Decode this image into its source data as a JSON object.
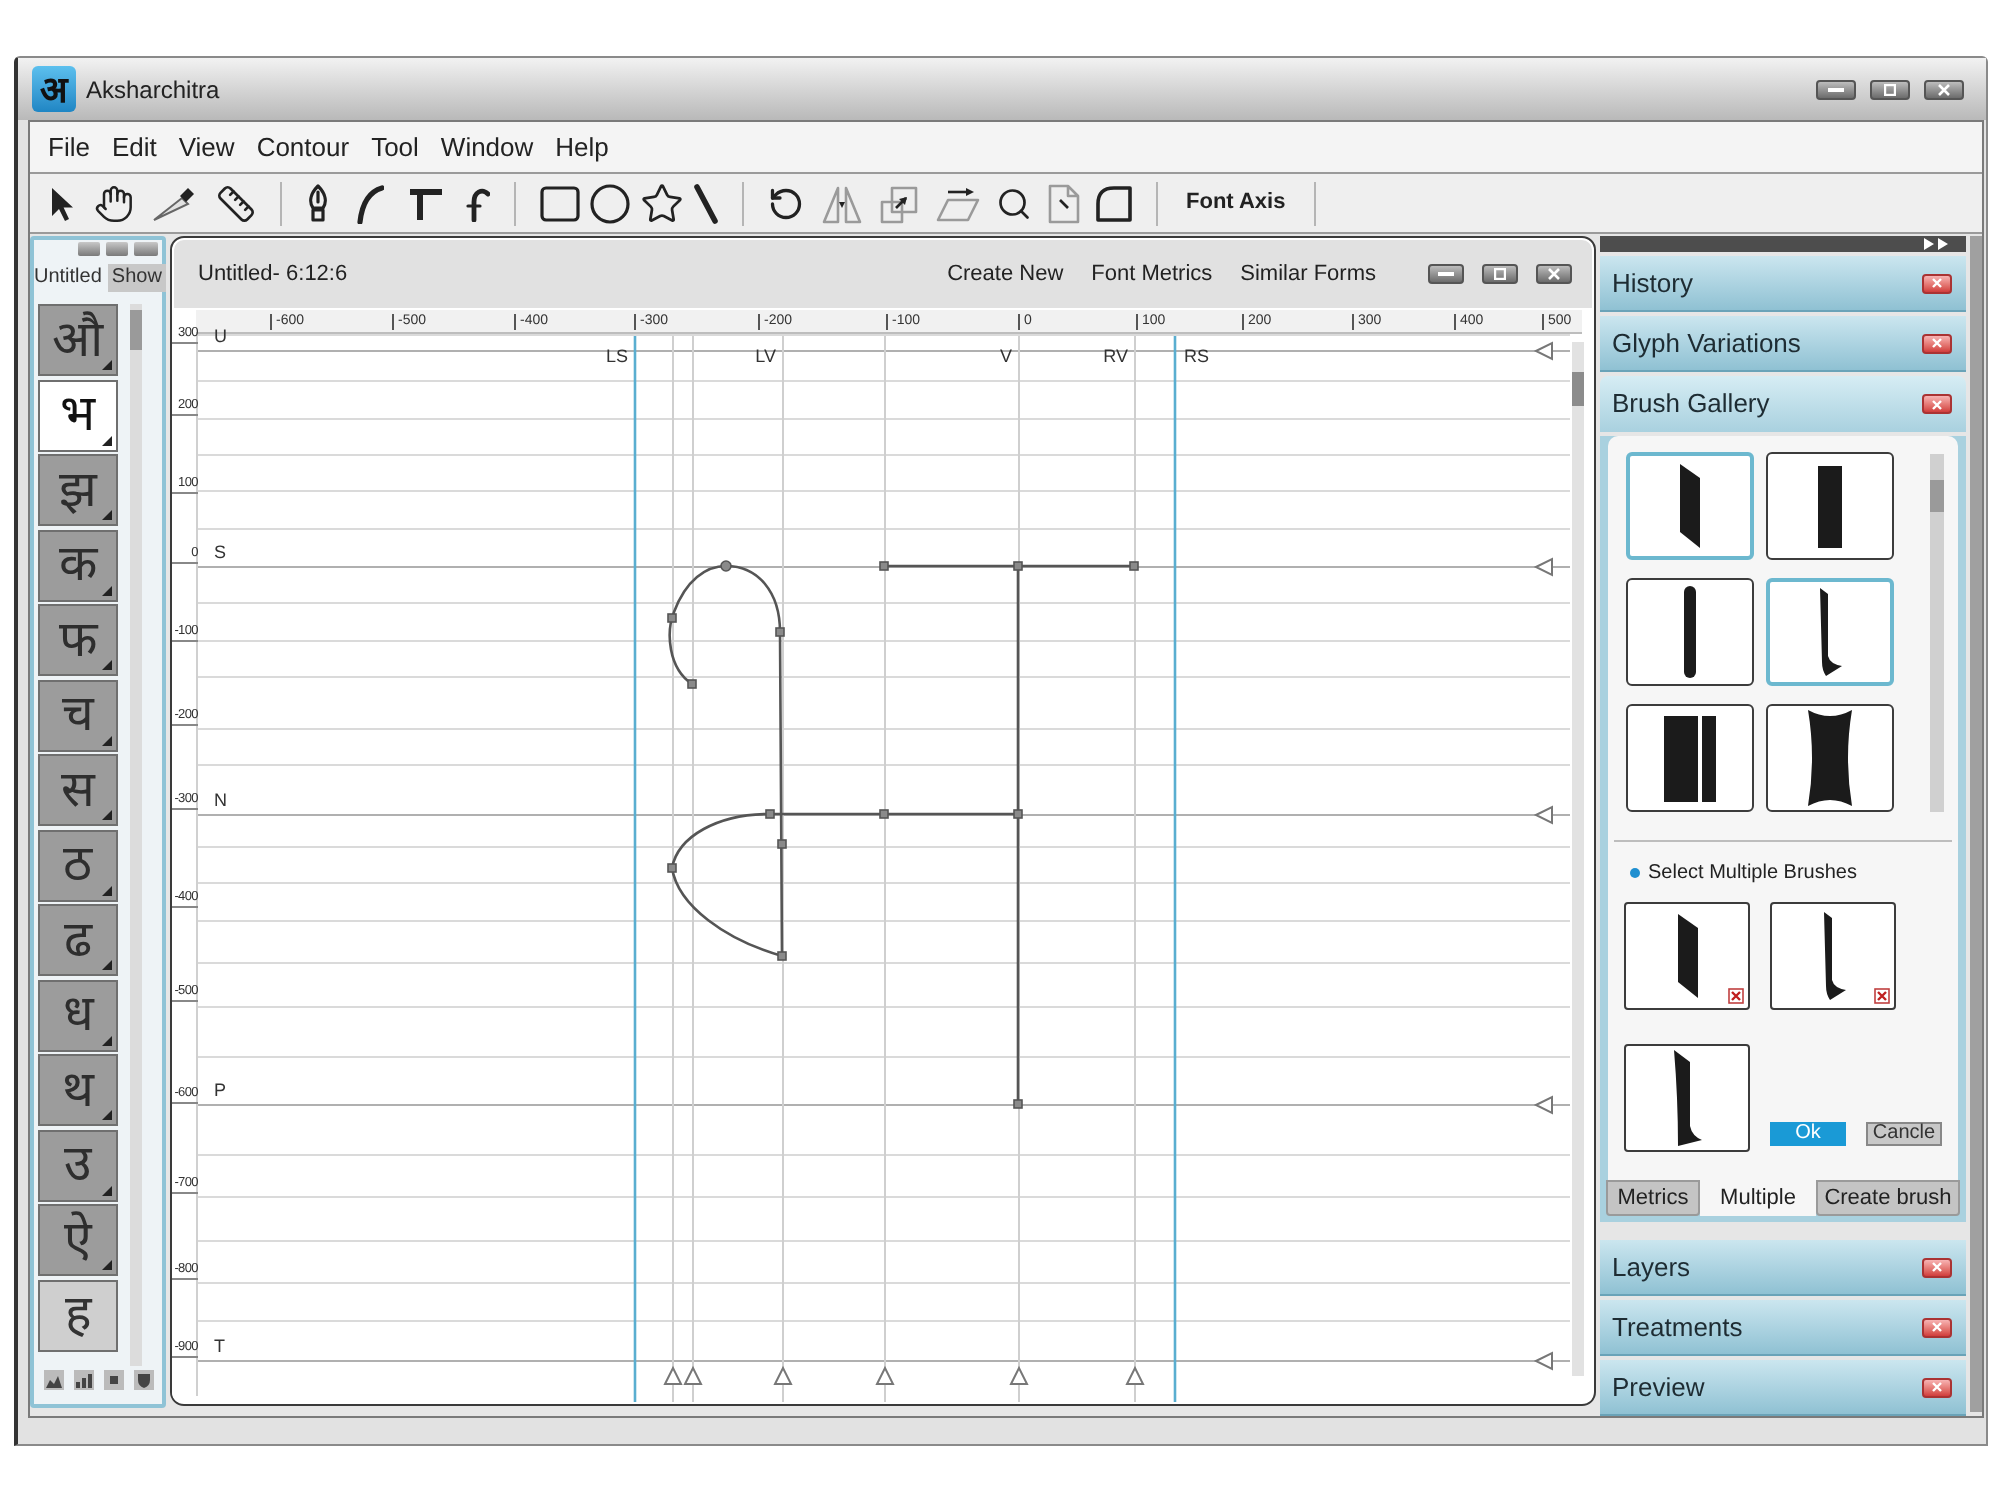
{
  "window": {
    "title": "Aksharchitra",
    "logo_letter": "अ"
  },
  "menu": [
    "File",
    "Edit",
    "View",
    "Contour",
    "Tool",
    "Window",
    "Help"
  ],
  "toolbar": {
    "text_buttons": [
      "Font Axis"
    ]
  },
  "glyph_panel": {
    "title": "Untitled",
    "show_button": "Show",
    "glyphs": [
      {
        "char": "औ",
        "selected": false,
        "highlighted": false,
        "has_variants": true
      },
      {
        "char": "भ",
        "selected": true,
        "highlighted": false,
        "has_variants": true
      },
      {
        "char": "झ",
        "selected": false,
        "highlighted": false,
        "has_variants": true
      },
      {
        "char": "क",
        "selected": false,
        "highlighted": false,
        "has_variants": true
      },
      {
        "char": "फ",
        "selected": false,
        "highlighted": false,
        "has_variants": true
      },
      {
        "char": "च",
        "selected": false,
        "highlighted": false,
        "has_variants": true
      },
      {
        "char": "स",
        "selected": false,
        "highlighted": false,
        "has_variants": true
      },
      {
        "char": "ठ",
        "selected": false,
        "highlighted": false,
        "has_variants": true
      },
      {
        "char": "ढ",
        "selected": false,
        "highlighted": false,
        "has_variants": true
      },
      {
        "char": "ध",
        "selected": false,
        "highlighted": false,
        "has_variants": true
      },
      {
        "char": "थ",
        "selected": false,
        "highlighted": false,
        "has_variants": true
      },
      {
        "char": "उ",
        "selected": false,
        "highlighted": false,
        "has_variants": true
      },
      {
        "char": "ऐ",
        "selected": false,
        "highlighted": false,
        "has_variants": true
      },
      {
        "char": "ह",
        "selected": false,
        "highlighted": true,
        "has_variants": false
      }
    ]
  },
  "editor": {
    "title": "Untitled- 6:12:6",
    "actions": [
      "Create New",
      "Font Metrics",
      "Similar Forms"
    ],
    "x_ruler": [
      "-600",
      "-500",
      "-400",
      "-300",
      "-200",
      "-100",
      "0",
      "100",
      "200",
      "300",
      "400",
      "500"
    ],
    "y_ruler": [
      "300",
      "200",
      "100",
      "0",
      "-100",
      "-200",
      "-300",
      "-400",
      "-500",
      "-600",
      "-700",
      "-800",
      "-900"
    ],
    "metric_lines": [
      "U",
      "S",
      "N",
      "P",
      "T"
    ],
    "guides": [
      {
        "kind": "side",
        "label": "LS"
      },
      {
        "kind": "stem"
      },
      {
        "kind": "stem"
      },
      {
        "kind": "stem",
        "label": "LV"
      },
      {
        "kind": "stem"
      },
      {
        "kind": "stem",
        "label": "V"
      },
      {
        "kind": "stem",
        "label": "RV"
      },
      {
        "kind": "side",
        "label": "RS"
      }
    ]
  },
  "side_panels": [
    {
      "title": "History",
      "expanded": false
    },
    {
      "title": "Glyph Variations",
      "expanded": false
    },
    {
      "title": "Brush Gallery",
      "expanded": true,
      "content": {
        "brushes": [
          {
            "kind": "slanted",
            "selected": true
          },
          {
            "kind": "block",
            "selected": false
          },
          {
            "kind": "rounded",
            "selected": false
          },
          {
            "kind": "flared",
            "selected": true
          },
          {
            "kind": "double",
            "selected": false
          },
          {
            "kind": "concave",
            "selected": false
          }
        ],
        "multi_select_label": "Select Multiple Brushes",
        "chosen": [
          {
            "kind": "slanted",
            "removable": true
          },
          {
            "kind": "flared",
            "removable": true
          },
          {
            "kind": "tapered",
            "removable": false
          }
        ],
        "ok_button": "Ok",
        "cancel_button": "Cancle",
        "tabs": [
          {
            "label": "Metrics",
            "selected": false
          },
          {
            "label": "Multiple",
            "selected": true
          },
          {
            "label": "Create brush",
            "selected": false
          }
        ]
      }
    },
    {
      "title": "Layers",
      "expanded": false
    },
    {
      "title": "Treatments",
      "expanded": false
    },
    {
      "title": "Preview",
      "expanded": false
    }
  ]
}
